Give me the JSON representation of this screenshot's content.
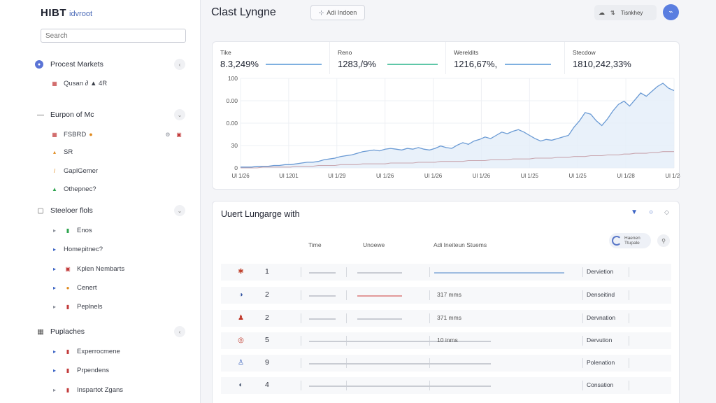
{
  "sidebar": {
    "brand": "HIBT",
    "brand_sub": "idvroot",
    "search_placeholder": "Search",
    "sections": [
      {
        "label": "Procest Markets",
        "icon": "circle-icon",
        "end_icon": "chevron-left-icon",
        "items": [
          {
            "label": "Qusan ∂ ▲ 4R",
            "icon": "calendar-icon"
          }
        ]
      },
      {
        "label": "Eurpon of Mc",
        "icon": "dash-icon",
        "end_icon": "chevron-down-icon",
        "items": [
          {
            "label": "FSBRD",
            "icon": "calendar-icon",
            "tail": "●"
          },
          {
            "label": "SR",
            "icon": "bolt-icon"
          },
          {
            "label": "GaplGemer",
            "icon": "pencil-icon"
          },
          {
            "label": "Othepnec?",
            "icon": "triangle-icon"
          }
        ]
      },
      {
        "label": "Steeloer flols",
        "icon": "square-icon",
        "end_icon": "chevron-down-icon",
        "items": [
          {
            "label": "Enos",
            "icon": "play-icon"
          },
          {
            "label": "Homepitnec?",
            "icon": "play-icon"
          },
          {
            "label": "Kplen Nembarts",
            "icon": "play-icon"
          },
          {
            "label": "Cenert",
            "icon": "play-icon"
          },
          {
            "label": "Peplnels",
            "icon": "play-icon"
          }
        ]
      },
      {
        "label": "Puplaches",
        "icon": "grid-icon",
        "end_icon": "chevron-left-icon",
        "items": [
          {
            "label": "Experrocmene",
            "icon": "play-icon"
          },
          {
            "label": "Prpendens",
            "icon": "play-icon"
          },
          {
            "label": "Inspartot Zgans",
            "icon": "play-icon"
          }
        ]
      }
    ]
  },
  "header": {
    "title": "Clast Lyngne",
    "add_button": "Adi Indoen",
    "pill_label": "Tisnkhey"
  },
  "stats": [
    {
      "label": "Tike",
      "value": "8.3,249%",
      "color": "#7fb0e0"
    },
    {
      "label": "Reno",
      "value": "1283,/9%",
      "color": "#5fc7a8"
    },
    {
      "label": "Wereldits",
      "value": "1216,67%,",
      "color": "#7fb0e0"
    },
    {
      "label": "Stecdow",
      "value": "1810,242,33%",
      "color": "#7fb0e0"
    }
  ],
  "chart_data": {
    "type": "area",
    "y_ticks": [
      "100",
      "0.00",
      "0.00",
      "30",
      "0"
    ],
    "x_ticks": [
      "Ul 1/26",
      "Ul 1201",
      "Ul 1/29",
      "Ul 1/26",
      "Ul 1/26",
      "Ul 1/26",
      "Ul 1/25",
      "Ul 1/25",
      "Ul 1/28",
      "Ul 1/24"
    ],
    "grid": true,
    "series": [
      {
        "color": "#6a9ad4",
        "values": [
          1,
          1,
          1,
          2,
          2,
          2,
          3,
          3,
          4,
          4,
          5,
          6,
          7,
          7,
          8,
          10,
          11,
          12,
          14,
          15,
          16,
          18,
          20,
          21,
          22,
          21,
          23,
          24,
          23,
          22,
          24,
          23,
          25,
          23,
          22,
          24,
          27,
          25,
          24,
          28,
          31,
          29,
          33,
          35,
          38,
          36,
          40,
          44,
          42,
          45,
          47,
          44,
          40,
          36,
          33,
          35,
          34,
          36,
          38,
          40,
          50,
          58,
          68,
          66,
          58,
          52,
          60,
          70,
          78,
          82,
          76,
          84,
          92,
          88,
          94,
          100,
          104,
          98,
          95
        ]
      },
      {
        "color": "#c9a7b0",
        "values": [
          0,
          0,
          0,
          0,
          1,
          1,
          1,
          1,
          1,
          1,
          2,
          2,
          2,
          2,
          3,
          3,
          3,
          3,
          4,
          4,
          4,
          4,
          5,
          5,
          5,
          5,
          5,
          6,
          6,
          6,
          6,
          6,
          7,
          7,
          7,
          7,
          8,
          8,
          8,
          8,
          8,
          9,
          9,
          9,
          9,
          10,
          10,
          10,
          10,
          11,
          11,
          11,
          11,
          12,
          12,
          12,
          12,
          13,
          13,
          13,
          14,
          14,
          14,
          15,
          15,
          15,
          16,
          16,
          16,
          17,
          17,
          18,
          18,
          18,
          19,
          19,
          20,
          20,
          20
        ]
      }
    ]
  },
  "table": {
    "title": "Uuert Lungarge with",
    "headers": [
      "Time",
      "Unoewe",
      "Adi Ineiteun Stuems"
    ],
    "badge_text": "Haenen Ttupale",
    "rows": [
      {
        "icon": "asterisk-icon",
        "icon_glyph": "✱",
        "icon_color": "#c0442f",
        "num": "1",
        "mid": "",
        "status": "Dervietion",
        "bar3": 1,
        "bar2_color": "#c9ccd3",
        "bar3_color": "#9fbde0"
      },
      {
        "icon": "globe-icon",
        "icon_glyph": "◑",
        "icon_color": "#2e4f9e",
        "num": "2",
        "mid": "317 mms",
        "status": "Denseitind",
        "bar3": 0,
        "bar2_color": "#e29a9a",
        "bar3_color": "#c9ccd3"
      },
      {
        "icon": "person-icon",
        "icon_glyph": "♟",
        "icon_color": "#c0392b",
        "num": "2",
        "mid": "371 mms",
        "status": "Dervnation",
        "bar3": 0,
        "bar2_color": "#c9ccd3",
        "bar3_color": "#c9ccd3"
      },
      {
        "icon": "target-icon",
        "icon_glyph": "◎",
        "icon_color": "#c0392b",
        "num": "5",
        "mid": "10 inms",
        "status": "Dervution",
        "bar3": 2,
        "bar2_color": "#c9ccd3",
        "bar3_color": "#c9ccd3"
      },
      {
        "icon": "user-icon",
        "icon_glyph": "♙",
        "icon_color": "#2a55b8",
        "num": "9",
        "mid": "",
        "status": "Polenation",
        "bar3": 2,
        "bar2_color": "#c9ccd3",
        "bar3_color": "#c9ccd3"
      },
      {
        "icon": "globe-icon",
        "icon_glyph": "◐",
        "icon_color": "#3b4a66",
        "num": "4",
        "mid": "",
        "status": "Consation",
        "bar3": 2,
        "bar2_color": "#c9ccd3",
        "bar3_color": "#c9ccd3"
      }
    ]
  }
}
